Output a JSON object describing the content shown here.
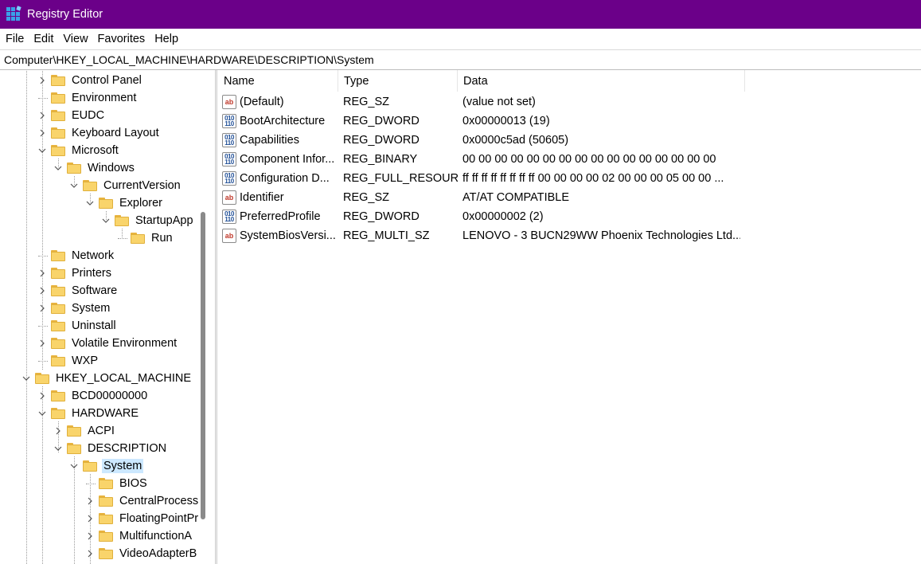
{
  "window": {
    "title": "Registry Editor",
    "title_bar_color": "#6b0089"
  },
  "menu": [
    "File",
    "Edit",
    "View",
    "Favorites",
    "Help"
  ],
  "address": "Computer\\HKEY_LOCAL_MACHINE\\HARDWARE\\DESCRIPTION\\System",
  "tree": [
    {
      "label": "Control Panel",
      "expander": ">",
      "level": 2
    },
    {
      "label": "Environment",
      "expander": "",
      "level": 2
    },
    {
      "label": "EUDC",
      "expander": ">",
      "level": 2
    },
    {
      "label": "Keyboard Layout",
      "expander": ">",
      "level": 2
    },
    {
      "label": "Microsoft",
      "expander": "v",
      "level": 2
    },
    {
      "label": "Windows",
      "expander": "v",
      "level": 3
    },
    {
      "label": "CurrentVersion",
      "expander": "v",
      "level": 4
    },
    {
      "label": "Explorer",
      "expander": "v",
      "level": 5
    },
    {
      "label": "StartupApp",
      "expander": "v",
      "level": 6
    },
    {
      "label": "Run",
      "expander": "",
      "level": 7
    },
    {
      "label": "Network",
      "expander": "",
      "level": 2
    },
    {
      "label": "Printers",
      "expander": ">",
      "level": 2
    },
    {
      "label": "Software",
      "expander": ">",
      "level": 2
    },
    {
      "label": "System",
      "expander": ">",
      "level": 2
    },
    {
      "label": "Uninstall",
      "expander": "",
      "level": 2
    },
    {
      "label": "Volatile Environment",
      "expander": ">",
      "level": 2
    },
    {
      "label": "WXP",
      "expander": "",
      "level": 2
    },
    {
      "label": "HKEY_LOCAL_MACHINE",
      "expander": "v",
      "level": 1
    },
    {
      "label": "BCD00000000",
      "expander": ">",
      "level": 2
    },
    {
      "label": "HARDWARE",
      "expander": "v",
      "level": 2
    },
    {
      "label": "ACPI",
      "expander": ">",
      "level": 3
    },
    {
      "label": "DESCRIPTION",
      "expander": "v",
      "level": 3
    },
    {
      "label": "System",
      "expander": "v",
      "level": 4,
      "selected": true
    },
    {
      "label": "BIOS",
      "expander": "",
      "level": 5
    },
    {
      "label": "CentralProcess",
      "expander": ">",
      "level": 5
    },
    {
      "label": "FloatingPointPr",
      "expander": ">",
      "level": 5
    },
    {
      "label": "MultifunctionA",
      "expander": ">",
      "level": 5
    },
    {
      "label": "VideoAdapterB",
      "expander": ">",
      "level": 5
    }
  ],
  "columns": {
    "name": "Name",
    "type": "Type",
    "data": "Data"
  },
  "values": [
    {
      "name": "(Default)",
      "type": "REG_SZ",
      "data": "(value not set)",
      "icon": "ab"
    },
    {
      "name": "BootArchitecture",
      "type": "REG_DWORD",
      "data": "0x00000013 (19)",
      "icon": "bin"
    },
    {
      "name": "Capabilities",
      "type": "REG_DWORD",
      "data": "0x0000c5ad (50605)",
      "icon": "bin"
    },
    {
      "name": "Component Infor...",
      "type": "REG_BINARY",
      "data": "00 00 00 00 00 00 00 00 00 00 00 00 00 00 00 00",
      "icon": "bin"
    },
    {
      "name": "Configuration D...",
      "type": "REG_FULL_RESOUR...",
      "data": "ff ff ff ff ff ff ff ff 00 00 00 00 02 00 00 00 05 00 00 ...",
      "icon": "bin"
    },
    {
      "name": "Identifier",
      "type": "REG_SZ",
      "data": "AT/AT COMPATIBLE",
      "icon": "ab"
    },
    {
      "name": "PreferredProfile",
      "type": "REG_DWORD",
      "data": "0x00000002 (2)",
      "icon": "bin"
    },
    {
      "name": "SystemBiosVersi...",
      "type": "REG_MULTI_SZ",
      "data": "LENOVO - 3 BUCN29WW Phoenix Technologies Ltd....",
      "icon": "ab"
    }
  ]
}
